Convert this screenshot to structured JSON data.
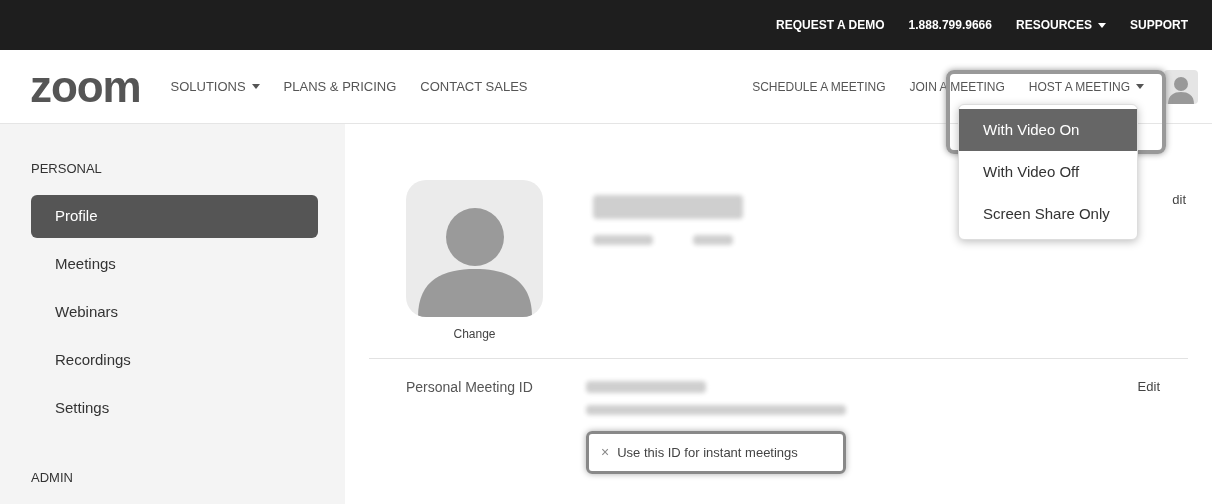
{
  "top_bar": {
    "links": [
      {
        "label": "REQUEST A DEMO",
        "caret": false
      },
      {
        "label": "1.888.799.9666",
        "caret": false
      },
      {
        "label": "RESOURCES",
        "caret": true
      },
      {
        "label": "SUPPORT",
        "caret": false
      }
    ]
  },
  "nav": {
    "logo": "zoom",
    "left_links": [
      {
        "label": "SOLUTIONS",
        "caret": true
      },
      {
        "label": "PLANS & PRICING",
        "caret": false
      },
      {
        "label": "CONTACT SALES",
        "caret": false
      }
    ],
    "right_links": [
      {
        "label": "SCHEDULE A MEETING",
        "caret": false
      },
      {
        "label": "JOIN A MEETING",
        "caret": false
      },
      {
        "label": "HOST A MEETING",
        "caret": true
      }
    ]
  },
  "host_menu": {
    "items": [
      {
        "label": "With Video On",
        "selected": true
      },
      {
        "label": "With Video Off",
        "selected": false
      },
      {
        "label": "Screen Share Only",
        "selected": false
      }
    ]
  },
  "sidebar": {
    "sections": [
      {
        "heading": "PERSONAL",
        "items": [
          {
            "label": "Profile",
            "selected": true
          },
          {
            "label": "Meetings",
            "selected": false
          },
          {
            "label": "Webinars",
            "selected": false
          },
          {
            "label": "Recordings",
            "selected": false
          },
          {
            "label": "Settings",
            "selected": false
          }
        ]
      },
      {
        "heading": "ADMIN"
      }
    ]
  },
  "profile": {
    "change_label": "Change",
    "edit_label": "dit"
  },
  "meeting_id": {
    "label": "Personal Meeting ID",
    "edit_label": "Edit",
    "option": {
      "mark": "×",
      "label": "Use this ID for instant meetings"
    }
  }
}
